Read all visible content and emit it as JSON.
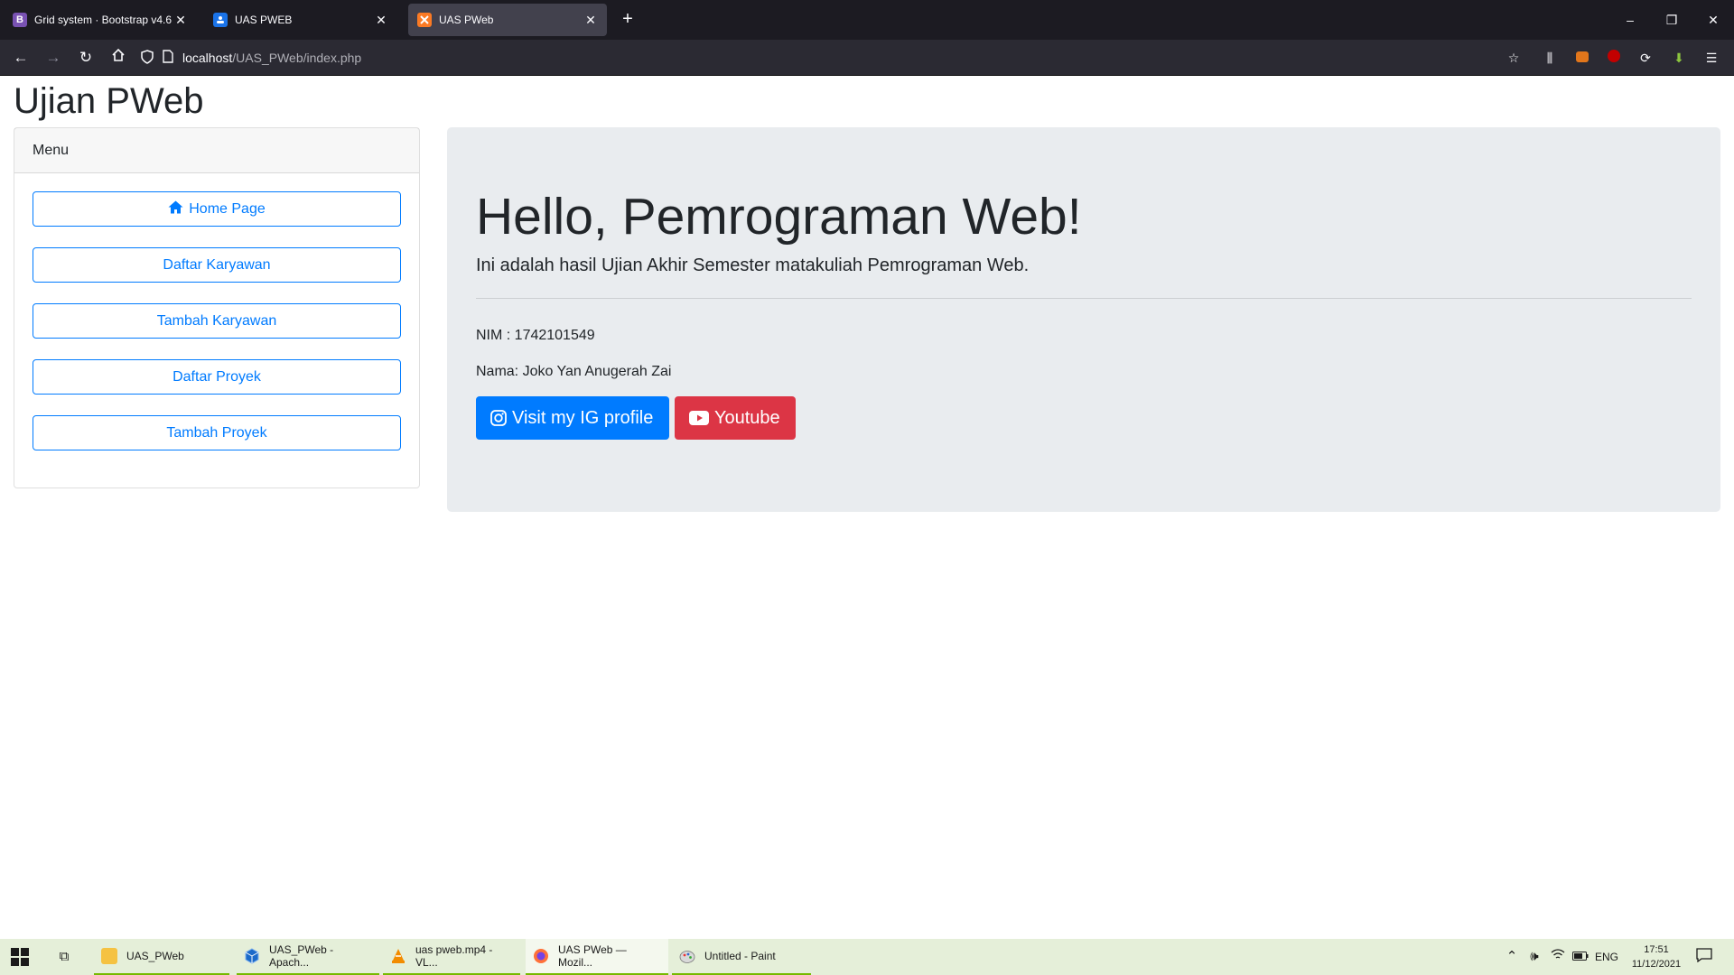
{
  "browser": {
    "tabs": [
      {
        "title": "Grid system · Bootstrap v4.6",
        "favicon": "bootstrap-icon",
        "favicon_letter": "B",
        "color": "#7952b3"
      },
      {
        "title": "UAS PWEB",
        "favicon": "classroom-icon",
        "favicon_letter": "",
        "color": "#1a73e8"
      },
      {
        "title": "UAS PWeb",
        "favicon": "xampp-icon",
        "favicon_letter": "",
        "color": "#fb7a24"
      }
    ],
    "active_tab": 2,
    "url_host": "localhost",
    "url_path": "/UAS_PWeb/index.php"
  },
  "page": {
    "title": "Ujian PWeb",
    "menu": {
      "header": "Menu",
      "items": [
        {
          "label": "Home Page",
          "icon": "home-icon"
        },
        {
          "label": "Daftar Karyawan"
        },
        {
          "label": "Tambah Karyawan"
        },
        {
          "label": "Daftar Proyek"
        },
        {
          "label": "Tambah Proyek"
        }
      ]
    },
    "jumbotron": {
      "heading": "Hello, Pemrograman Web!",
      "lead": "Ini adalah hasil Ujian Akhir Semester matakuliah Pemrograman Web.",
      "nim": "NIM : 1742101549",
      "nama": "Nama: Joko Yan Anugerah Zai",
      "btn_ig": "Visit my IG profile",
      "btn_yt": "Youtube"
    },
    "colors": {
      "primary": "#007bff",
      "danger": "#dc3545",
      "jumbotron_bg": "#e9ecef"
    }
  },
  "taskbar": {
    "items": [
      {
        "label": "UAS_PWeb",
        "icon": "folder-icon"
      },
      {
        "label": "UAS_PWeb - Apach...",
        "icon": "netbeans-icon"
      },
      {
        "label": "uas pweb.mp4 - VL...",
        "icon": "vlc-icon"
      },
      {
        "label": "UAS PWeb — Mozil...",
        "icon": "firefox-icon"
      },
      {
        "label": "Untitled - Paint",
        "icon": "paint-icon"
      }
    ],
    "language": "ENG",
    "time": "17:51",
    "date": "11/12/2021"
  }
}
